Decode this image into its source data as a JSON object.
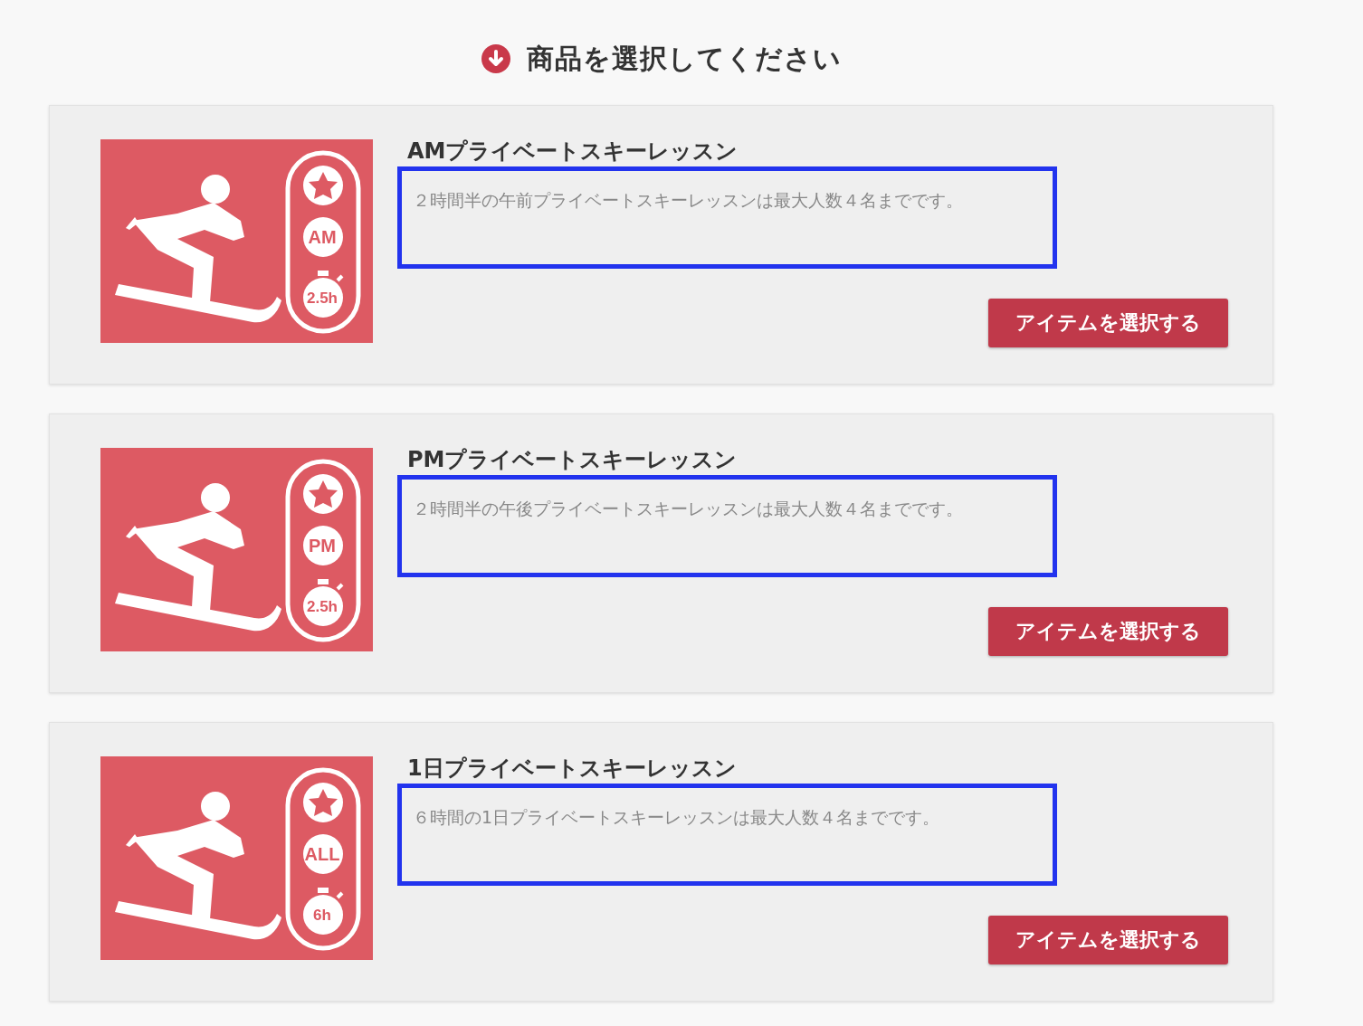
{
  "heading": {
    "text": "商品を選択してください"
  },
  "products": [
    {
      "title": "AMプライベートスキーレッスン",
      "description": "２時間半の午前プライベートスキーレッスンは最大人数４名までです。",
      "period": "AM",
      "duration": "2.5h",
      "highlighted": true,
      "button": "アイテムを選択する"
    },
    {
      "title": "PMプライベートスキーレッスン",
      "description": "２時間半の午後プライベートスキーレッスンは最大人数４名までです。",
      "period": "PM",
      "duration": "2.5h",
      "highlighted": true,
      "button": "アイテムを選択する"
    },
    {
      "title": "1日プライベートスキーレッスン",
      "description": "６時間の1日プライベートスキーレッスンは最大人数４名までです。",
      "period": "ALL",
      "duration": "6h",
      "highlighted": true,
      "button": "アイテムを選択する"
    }
  ]
}
